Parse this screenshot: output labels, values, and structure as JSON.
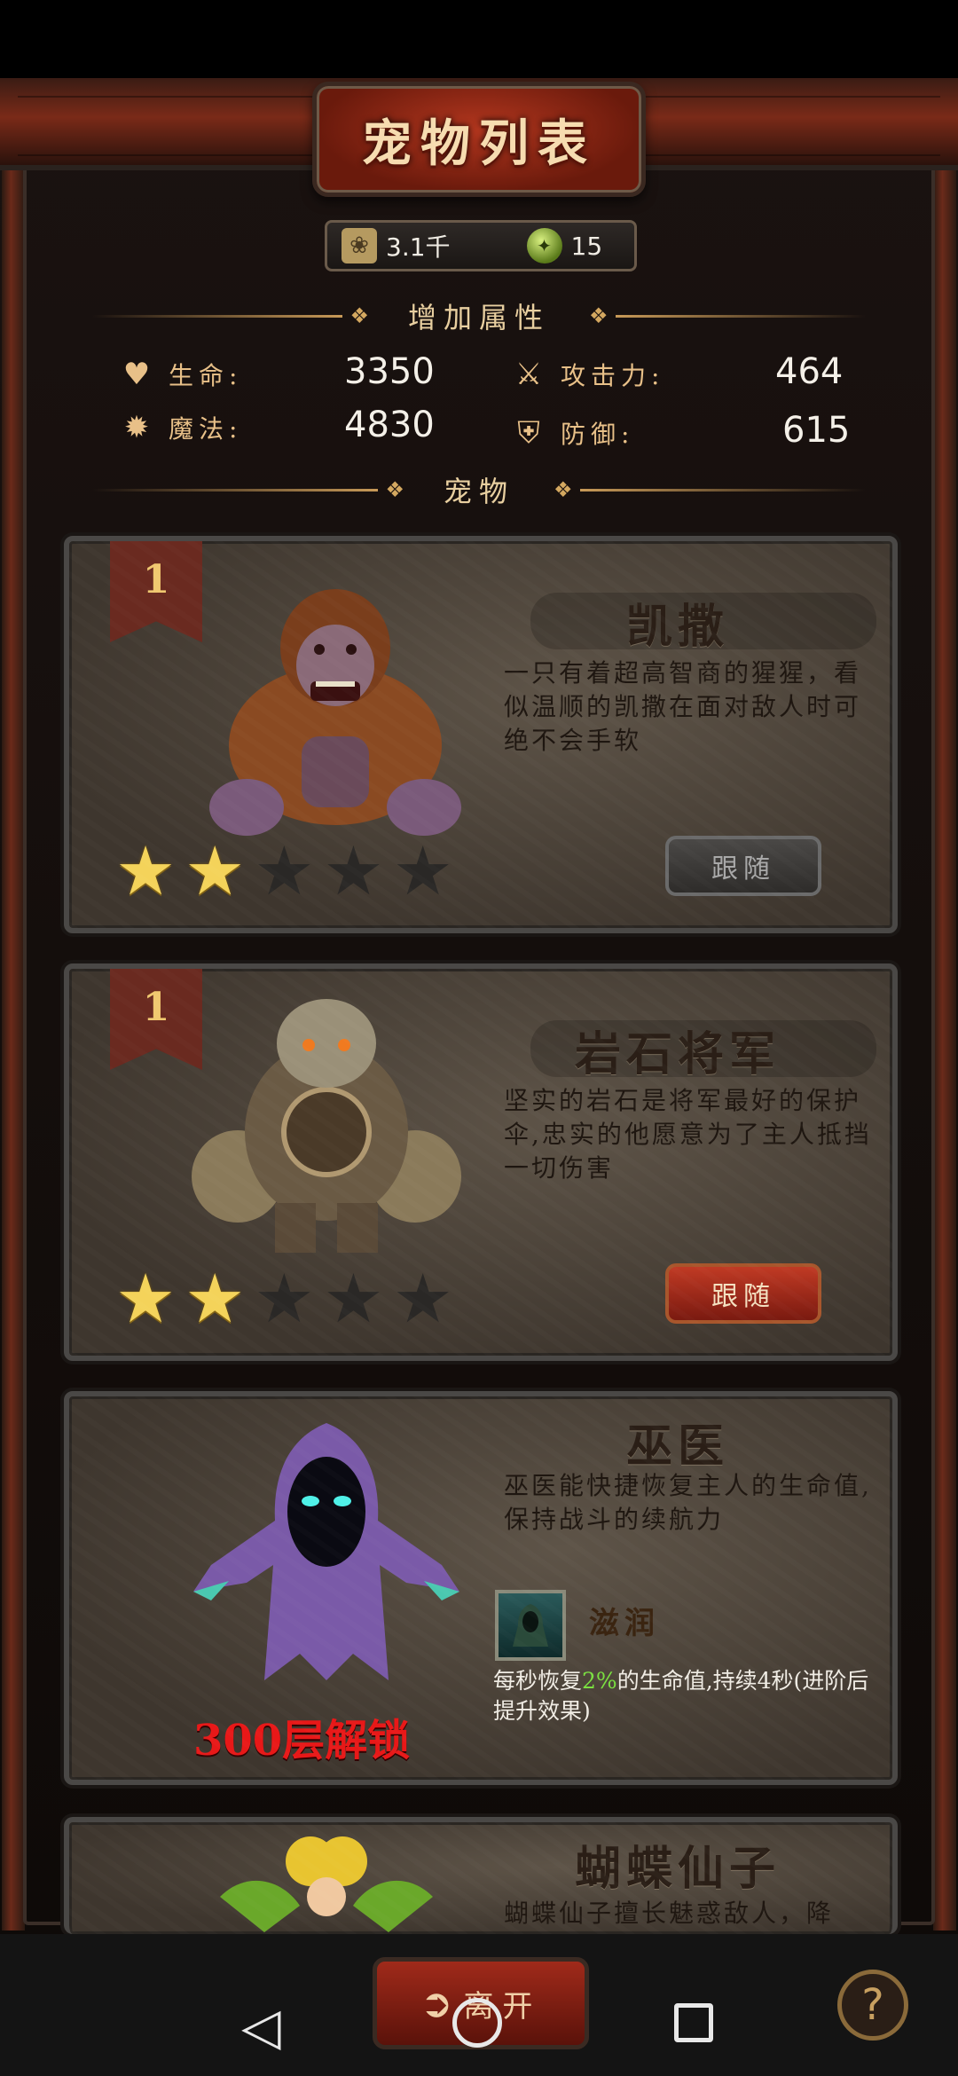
{
  "title": "宠物列表",
  "resources": {
    "paw_value": "3.1千",
    "orb_value": "15"
  },
  "attr_section": {
    "title": "增加属性"
  },
  "stats": {
    "hp": {
      "label": "生命:",
      "value": "3350"
    },
    "mp": {
      "label": "魔法:",
      "value": "4830"
    },
    "atk": {
      "label": "攻击力:",
      "value": "464"
    },
    "def": {
      "label": "防御:",
      "value": "615"
    }
  },
  "pets_section": {
    "title": "宠物"
  },
  "pets": [
    {
      "rank": "1",
      "name": "凯撒",
      "description": "一只有着超高智商的猩猩，看似温顺的凯撒在面对敌人时可绝不会手软",
      "stars": 2,
      "max_stars": 5,
      "button": "跟随",
      "button_state": "disabled"
    },
    {
      "rank": "1",
      "name": "岩石将军",
      "description": "坚实的岩石是将军最好的保护伞,忠实的他愿意为了主人抵挡一切伤害",
      "stars": 2,
      "max_stars": 5,
      "button": "跟随",
      "button_state": "active"
    },
    {
      "name": "巫医",
      "description": "巫医能快捷恢复主人的生命值,保持战斗的续航力",
      "skill_name": "滋润",
      "skill_desc_a": "每秒恢复",
      "skill_desc_hl": "2%",
      "skill_desc_b": "的生命值,持续4秒(进阶后提升效果)",
      "unlock": "300层解锁"
    },
    {
      "name": "蝴蝶仙子",
      "description": "蝴蝶仙子擅长魅惑敌人，降"
    }
  ],
  "bottom": {
    "exit_label": "离开",
    "help": "?"
  },
  "colors": {
    "accent_red": "#b2361e",
    "star_gold": "#f4d35a",
    "highlight_green": "#7ae040",
    "unlock_red": "#e81818"
  }
}
